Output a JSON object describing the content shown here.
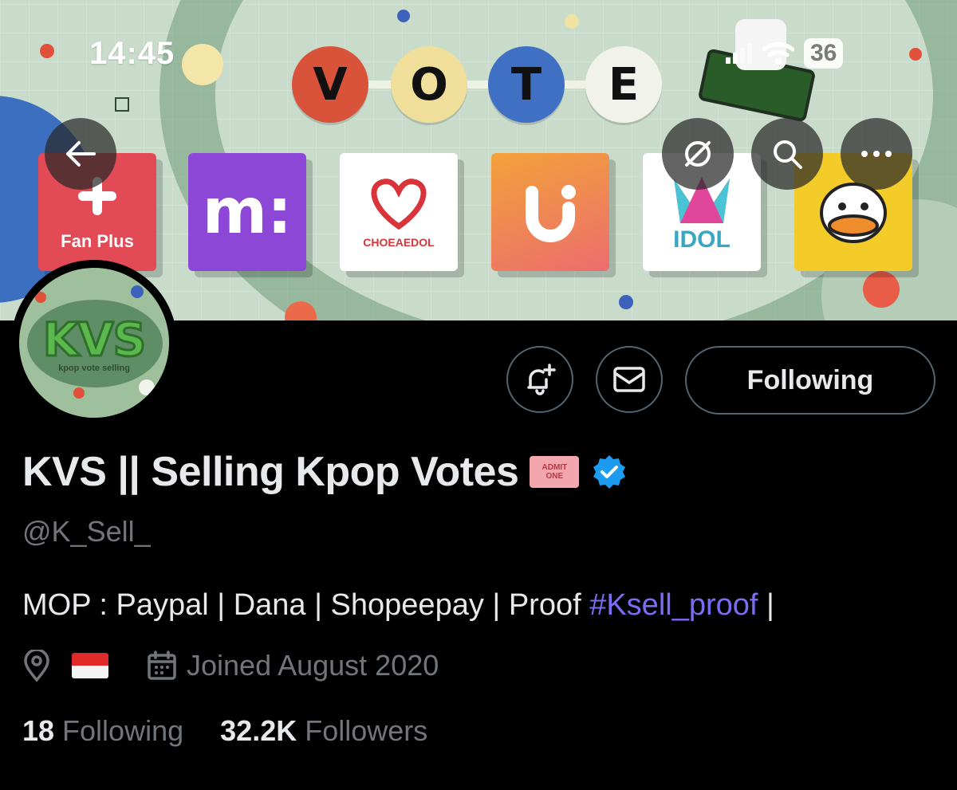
{
  "status_bar": {
    "time": "14:45",
    "battery": "36"
  },
  "banner": {
    "vote_letters": [
      "V",
      "O",
      "T",
      "E"
    ],
    "apps": [
      {
        "label": "Fan Plus",
        "color": "#e24a55"
      },
      {
        "label": "m:",
        "color": "#8c47d6"
      },
      {
        "label": "CHOEAEDOL",
        "color": "#ffffff"
      },
      {
        "label": "U",
        "color": "#ef8a3a"
      },
      {
        "label": "IDOL",
        "color": "#ffffff"
      },
      {
        "label": "duck",
        "color": "#f4cc2a"
      }
    ]
  },
  "nav": {
    "back_icon": "back-arrow-icon",
    "translate_icon": "translate-off-icon",
    "search_icon": "search-icon",
    "more_icon": "more-icon"
  },
  "profile": {
    "avatar_text": "KVS",
    "avatar_subtext": "kpop vote selling",
    "display_name": "KVS || Selling Kpop Votes",
    "ticket_line1": "ADMIT",
    "ticket_line2": "ONE",
    "verified": true,
    "handle": "@K_Sell_",
    "bio_text": "MOP : Paypal | Dana | Shopeepay | Proof ",
    "bio_hashtag": "#Ksell_proof",
    "bio_suffix": " |",
    "location_flag": "Indonesia flag",
    "joined": "Joined August 2020",
    "following_count": "18",
    "following_label": " Following",
    "followers_count": "32.2K",
    "followers_label": " Followers"
  },
  "actions": {
    "follow_label": "Following",
    "notify_icon": "bell-plus-icon",
    "message_icon": "envelope-icon"
  },
  "colors": {
    "accent_link": "#7b6cf6",
    "verified_blue": "#1d9bf0",
    "muted": "#71767b"
  }
}
